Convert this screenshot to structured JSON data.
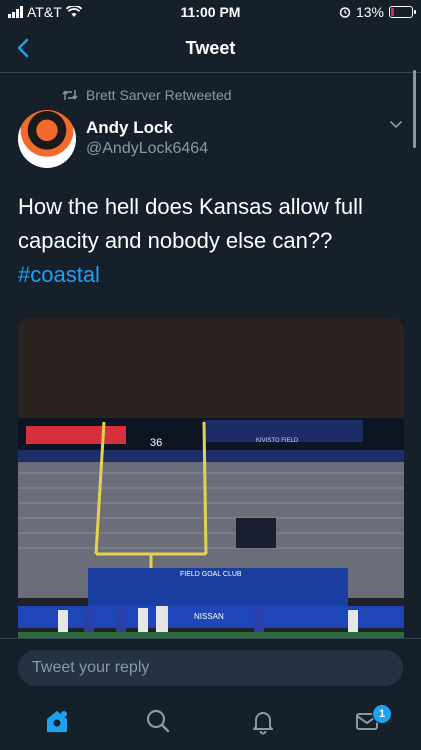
{
  "status_bar": {
    "carrier": "AT&T",
    "time": "11:00 PM",
    "battery_percent": "13%",
    "battery_level": 0.13
  },
  "nav": {
    "title": "Tweet"
  },
  "tweet": {
    "retweeted_by": "Brett Sarver Retweeted",
    "display_name": "Andy Lock",
    "handle": "@AndyLock6464",
    "text": "How the hell does Kansas allow full capacity and nobody else can??",
    "hashtag": "#coastal"
  },
  "media": {
    "banner_text": "FIELD GOAL CLUB",
    "sponsor_text": "NISSAN",
    "stadium_sign": "KIVISTO FIELD",
    "scoreboard_digit": "36"
  },
  "reply": {
    "placeholder": "Tweet your reply"
  },
  "tabs": {
    "notifications_badge": "1"
  },
  "colors": {
    "background": "#15202b",
    "accent": "#1da1f2",
    "secondary_text": "#8899a6",
    "battery_low": "#e0245e"
  }
}
